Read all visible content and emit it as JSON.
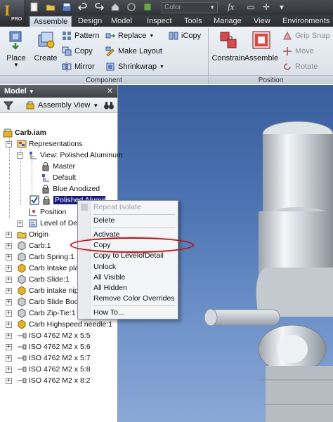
{
  "app": {
    "logo": "I",
    "edition": "PRO"
  },
  "quick_access": {
    "color_value": "Color",
    "fx_label": "fx"
  },
  "ribbon_tabs": [
    "Assemble",
    "Design",
    "Model",
    "Inspect",
    "Tools",
    "Manage",
    "View",
    "Environments"
  ],
  "active_tab": "Assemble",
  "ribbon": {
    "place_label": "Place",
    "create_label": "Create",
    "pattern_label": "Pattern",
    "copy_label": "Copy",
    "mirror_label": "Mirror",
    "replace_label": "Replace",
    "make_layout_label": "Make Layout",
    "shrinkwrap_label": "Shrinkwrap",
    "icopy_label": "iCopy",
    "component_panel": "Component",
    "constrain_label": "Constrain",
    "assemble_label": "Assemble",
    "grip_snap_label": "Grip Snap",
    "move_label": "Move",
    "rotate_label": "Rotate",
    "position_panel": "Position"
  },
  "browser": {
    "title": "Model",
    "view_label": "Assembly View",
    "tree": {
      "root": "Carb.iam",
      "representations": "Representations",
      "view_rep": "View: Polished Aluminum",
      "master": "Master",
      "default": "Default",
      "blue_anodized": "Blue Anodized",
      "polished_aluminum": "Polished Aluminum",
      "position": "Position",
      "level_of_detail": "Level of Detail",
      "origin": "Origin",
      "items": [
        "Carb:1",
        "Carb Spring:1",
        "Carb Intake plate",
        "Carb Slide:1",
        "Carb intake nipple",
        "Carb Slide Boot:1",
        "Carb Zip-Tie:1",
        "Carb Highspeed needle:1",
        "ISO 4762 M2 x 5:5",
        "ISO 4762 M2 x 5:6",
        "ISO 4762 M2 x 5:7",
        "ISO 4762 M2 x 5:8",
        "ISO 4762 M2 x 8:2"
      ]
    }
  },
  "context_menu": {
    "repeat_isolate": "Repeat Isolate",
    "delete": "Delete",
    "activate": "Activate",
    "copy": "Copy",
    "copy_to_lod": "Copy to LevelofDetail",
    "unlock": "Unlock",
    "all_visible": "All Visible",
    "all_hidden": "All Hidden",
    "remove_color_overrides": "Remove Color Overrides",
    "how_to": "How To..."
  },
  "colors": {
    "highlight_ellipse": "#b3121b",
    "selection": "#1a1a7a",
    "viewport_top": "#3a5e9e",
    "viewport_bottom": "#8aa8d6"
  }
}
